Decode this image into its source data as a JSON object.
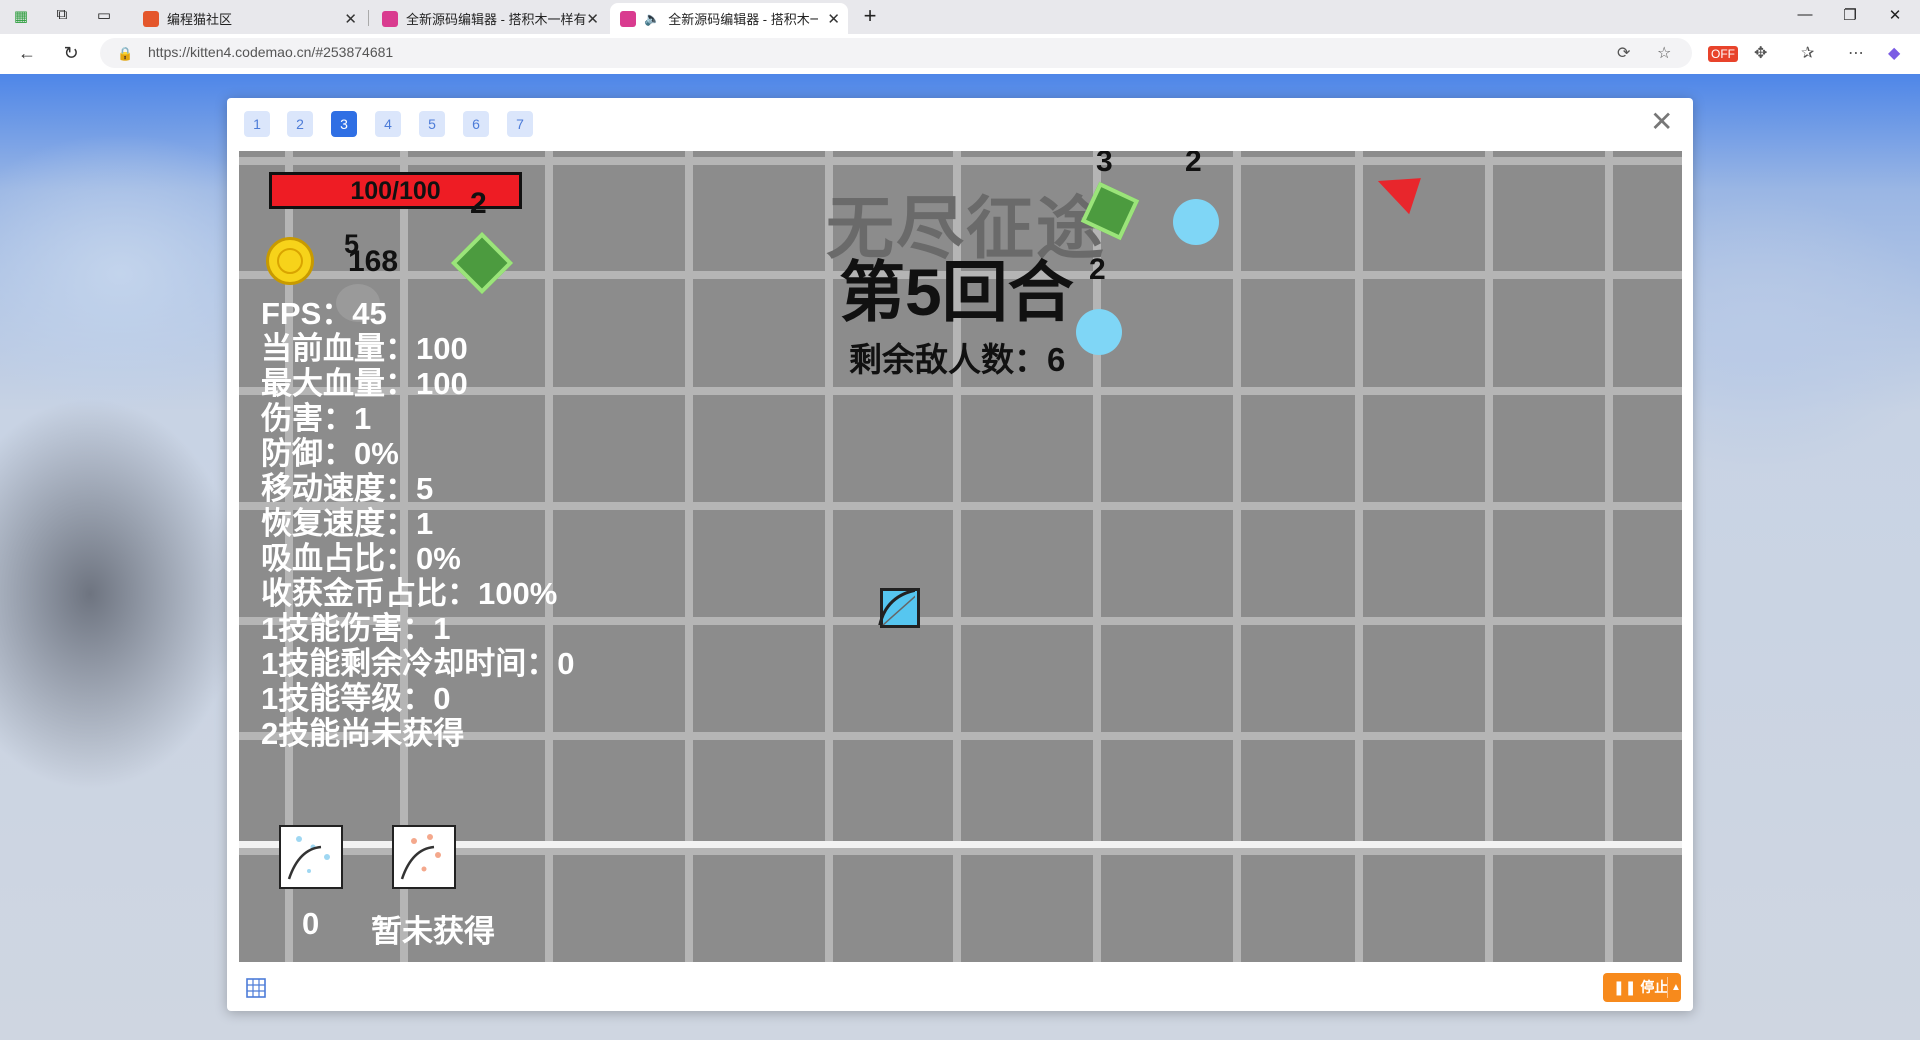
{
  "browser": {
    "tabs": [
      {
        "title": "编程猫社区",
        "favicon_color": "#e4562b"
      },
      {
        "title": "全新源码编辑器 - 搭积木一样有趣",
        "favicon_color": "#d93b8f"
      },
      {
        "title": "全新源码编辑器 - 搭积木一样",
        "favicon_color": "#d93b8f"
      }
    ],
    "url": "https://kitten4.codemao.cn/#253874681"
  },
  "dialog": {
    "pages": [
      "1",
      "2",
      "3",
      "4",
      "5",
      "6",
      "7"
    ],
    "active_page": "3",
    "stop_label": "停止"
  },
  "game": {
    "hp": "100/100",
    "coins": "168",
    "small_num": "5",
    "title": "无尽征途",
    "round": "第5回合",
    "enemies_left": "剩余敌人数：6",
    "stats": [
      "FPS：45",
      "当前血量：100",
      "最大血量：100",
      "伤害：1",
      "防御：0%",
      "移动速度：5",
      "恢复速度：1",
      "吸血占比：0%",
      "收获金币占比：100%",
      "1技能伤害：1",
      "1技能剩余冷却时间：0",
      "1技能等级：0",
      "2技能尚未获得"
    ],
    "enemy_labels": [
      "2",
      "3",
      "2",
      "2"
    ],
    "skill1_label": "0",
    "skill2_label": "暂未获得"
  }
}
